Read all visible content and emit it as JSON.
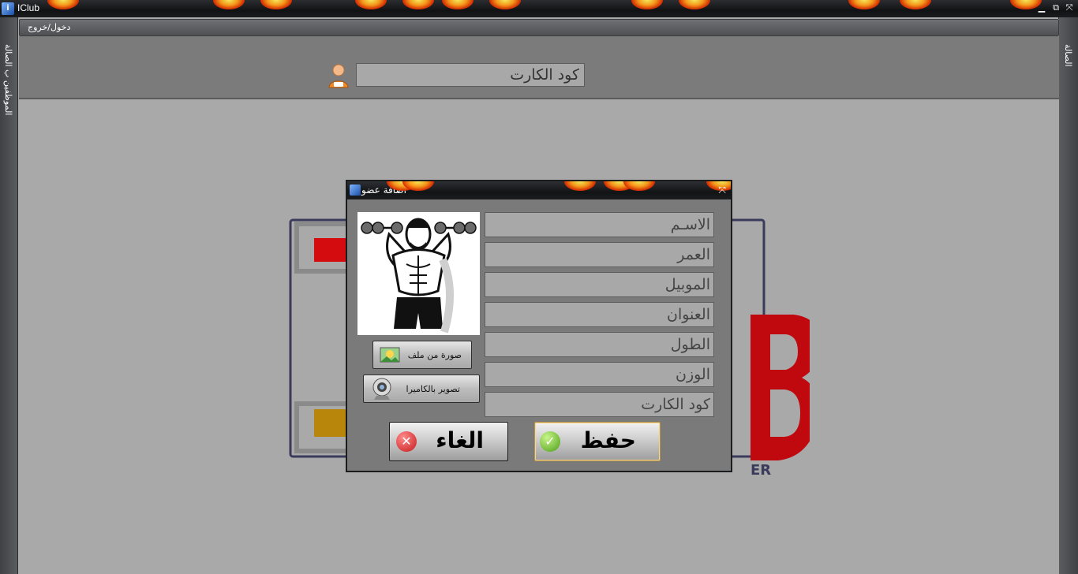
{
  "window": {
    "title": "IClub",
    "app_icon": "iclub-app-icon",
    "controls": [
      "minimize",
      "restore",
      "fullscreen"
    ]
  },
  "sidebar_left": {
    "label": "الموظفين ب الصالة"
  },
  "sidebar_right": {
    "label": "الصالة"
  },
  "menu": {
    "item": "دخول/خروج"
  },
  "toolbar": {
    "card_placeholder": "كود الكارت"
  },
  "dialog": {
    "title": "اضافة عضو",
    "fields": [
      {
        "name": "name",
        "placeholder": "الاسـم"
      },
      {
        "name": "age",
        "placeholder": "العمر"
      },
      {
        "name": "mobile",
        "placeholder": "الموبيل"
      },
      {
        "name": "address",
        "placeholder": "العنوان"
      },
      {
        "name": "height",
        "placeholder": "الطول"
      },
      {
        "name": "weight",
        "placeholder": "الوزن"
      },
      {
        "name": "card-code",
        "placeholder": "كود الكارت"
      }
    ],
    "photo_from_file_label": "صورة من ملف",
    "camera_capture_label": "تصوير بالكاميرا",
    "save_label": "حفظ",
    "cancel_label": "الغاء"
  },
  "colors": {
    "background": "#a9a9a9",
    "logo_red": "#c0090f",
    "logo_gold": "#b8860b",
    "titlebar": "#121315"
  }
}
